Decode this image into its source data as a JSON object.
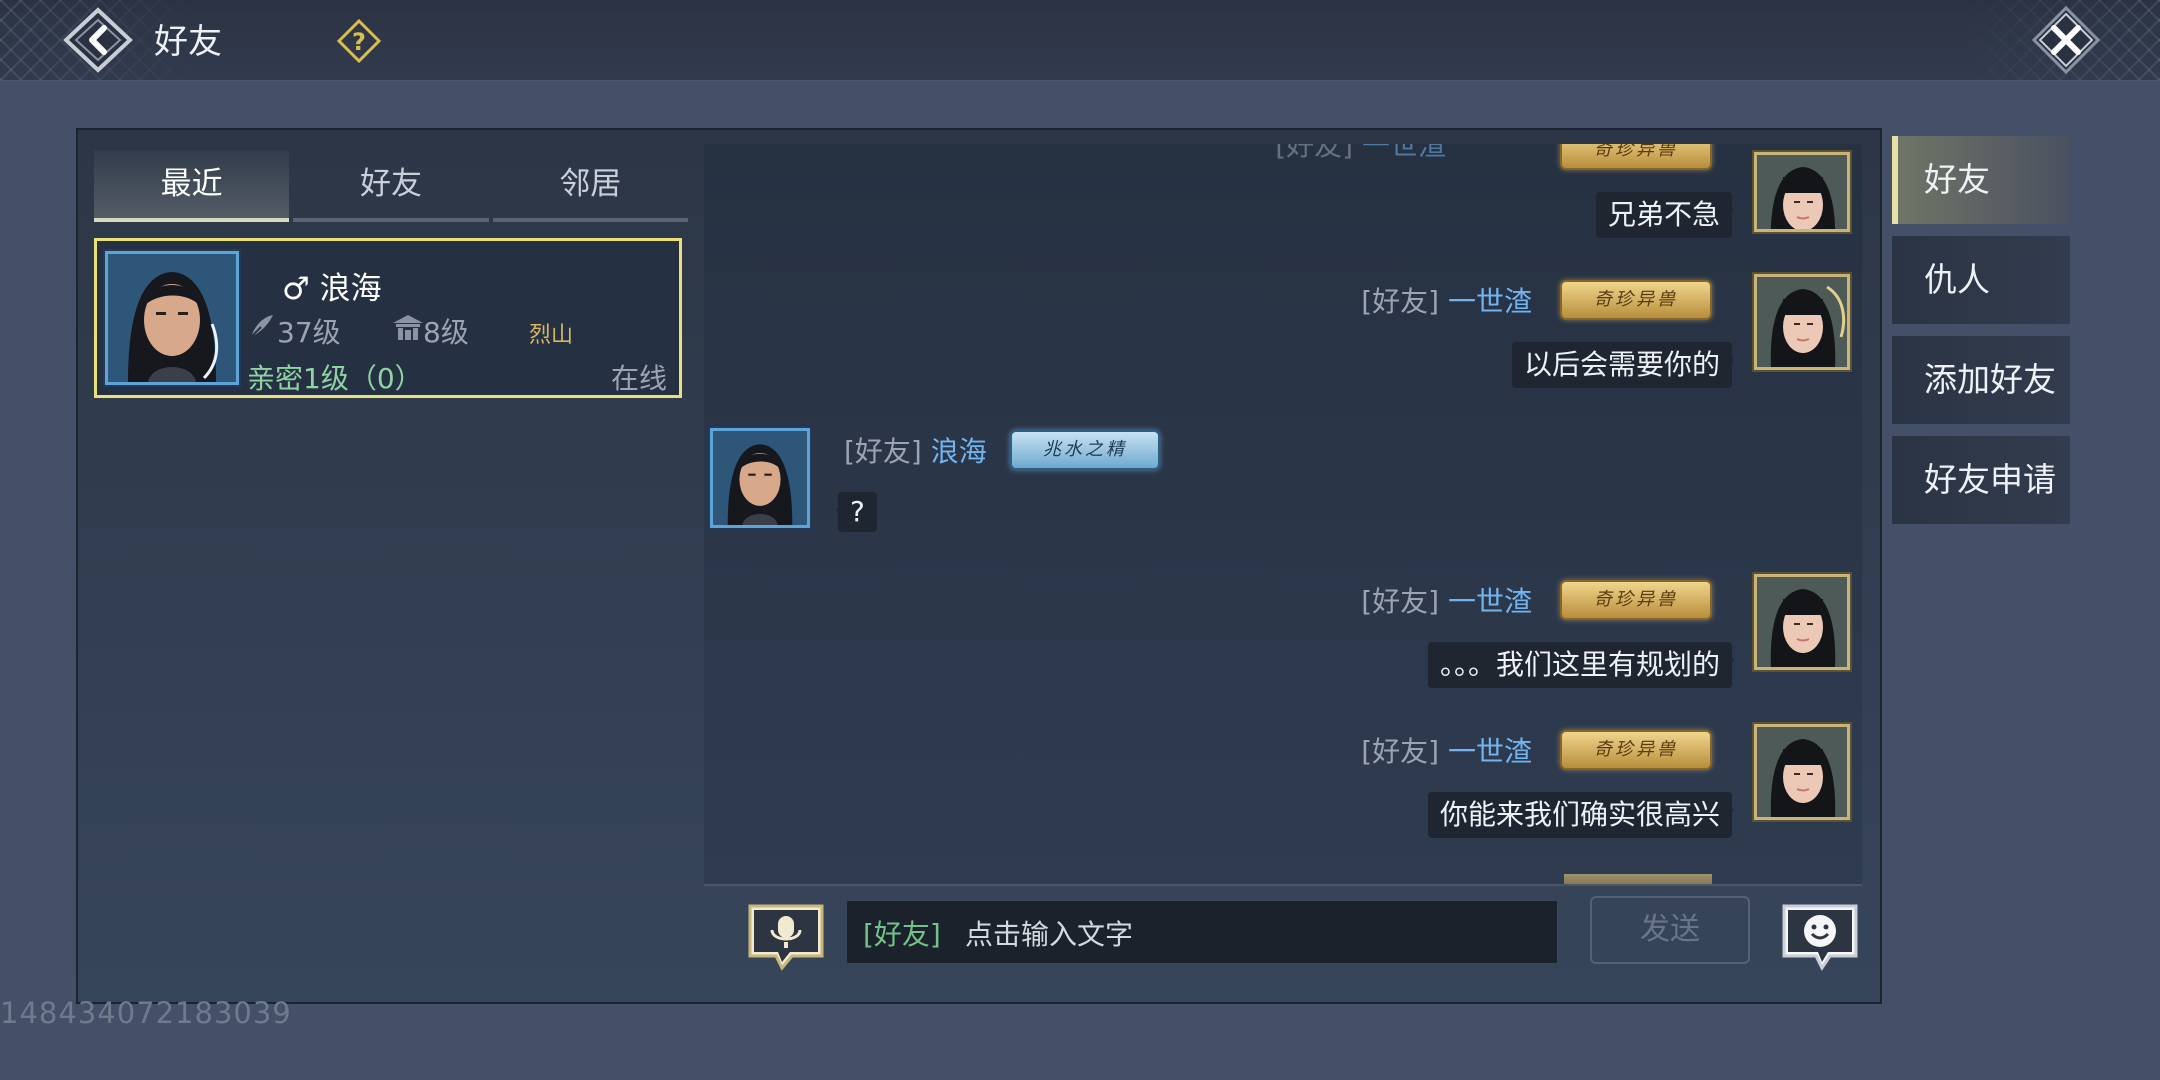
{
  "header": {
    "title": "好友"
  },
  "tabs": [
    {
      "label": "最近",
      "active": true
    },
    {
      "label": "好友",
      "active": false
    },
    {
      "label": "邻居",
      "active": false
    }
  ],
  "friend": {
    "gender_symbol": "♂",
    "name": "浪海",
    "level": "37级",
    "house_level": "8级",
    "guild": "烈山",
    "intimacy": "亲密1级（0）",
    "status": "在线"
  },
  "messages": [
    {
      "side": "right",
      "channel": "[好友]",
      "name": "一世渣",
      "badge": "奇珍异兽",
      "text": "兄弟不急"
    },
    {
      "side": "right",
      "channel": "[好友]",
      "name": "一世渣",
      "badge": "奇珍异兽",
      "text": "以后会需要你的"
    },
    {
      "side": "left",
      "channel": "[好友]",
      "name": "浪海",
      "badge": "兆水之精",
      "text": "?"
    },
    {
      "side": "right",
      "channel": "[好友]",
      "name": "一世渣",
      "badge": "奇珍异兽",
      "text": "。。。我们这里有规划的"
    },
    {
      "side": "right",
      "channel": "[好友]",
      "name": "一世渣",
      "badge": "奇珍异兽",
      "text": "你能来我们确实很高兴"
    }
  ],
  "input": {
    "channel": "[好友]",
    "placeholder": "点击输入文字"
  },
  "send_label": "发送",
  "side_tabs": [
    {
      "label": "好友",
      "active": true
    },
    {
      "label": "仇人",
      "active": false
    },
    {
      "label": "添加好友",
      "active": false
    },
    {
      "label": "好友申请",
      "active": false
    }
  ],
  "uid": "148434072183039",
  "icons": {
    "back": "back-arrow-icon",
    "help": "question-icon",
    "close": "close-icon",
    "voice": "microphone-icon",
    "emoji": "smiley-icon",
    "level": "feather-icon",
    "house": "house-icon"
  },
  "colors": {
    "name_blue": "#72b4f0",
    "highlight": "#e9e07a",
    "intimacy": "#8fd3a2",
    "channel_green": "#72c289"
  }
}
